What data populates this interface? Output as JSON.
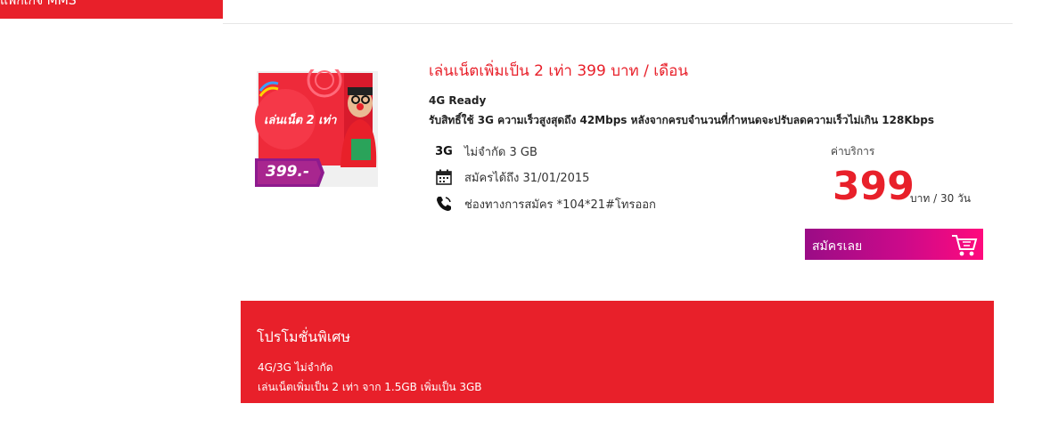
{
  "top_tab": {
    "label": "แพ็กเกจ MMS"
  },
  "package": {
    "image_text": "เล่นเน็ต 2 เท่า",
    "image_price": "399.-",
    "title": "เล่นเน็ตเพิ่มเป็น 2 เท่า 399 บาท / เดือน",
    "ready": "4G Ready",
    "description": "รับสิทธิ์ใช้ 3G ความเร็วสูงสุดถึง 42Mbps หลังจากครบจำนวนที่กำหนดจะปรับลดความเร็วไม่เกิน 128Kbps",
    "features": [
      {
        "icon": "3g-icon",
        "icon_text": "3G",
        "text": "ไม่จำกัด 3 GB"
      },
      {
        "icon": "calendar-icon",
        "text": "สมัครได้ถึง 31/01/2015"
      },
      {
        "icon": "phone-icon",
        "text": "ช่องทางการสมัคร *104*21#โทรออก"
      }
    ],
    "price_label": "ค่าบริการ",
    "price": "399",
    "price_unit": "บาท / 30 วัน",
    "subscribe_label": "สมัครเลย"
  },
  "promo": {
    "title": "โปรโมชั่นพิเศษ",
    "line1": "4G/3G ไม่จำกัด",
    "line2": "เล่นเน็ตเพิ่มเป็น 2 เท่า จาก 1.5GB เพิ่มเป็น 3GB"
  },
  "colors": {
    "brand_red": "#e8202a",
    "magenta": "#cc0a8a",
    "purple": "#9a0c86"
  }
}
